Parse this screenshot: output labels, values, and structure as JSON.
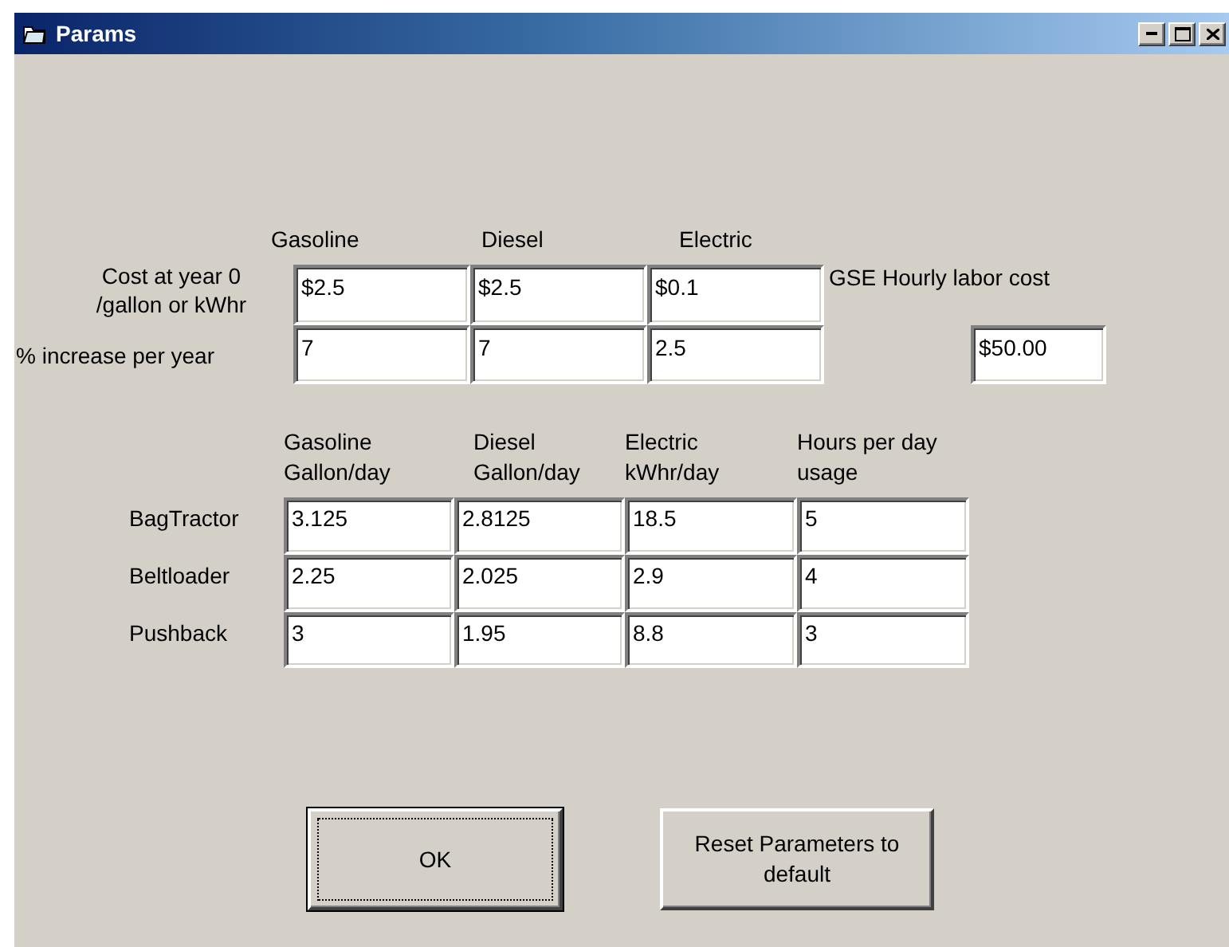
{
  "window": {
    "title": "Params"
  },
  "fuel_costs": {
    "columns": [
      "Gasoline",
      "Diesel",
      "Electric"
    ],
    "rows": [
      {
        "label": [
          "Cost at year 0",
          "/gallon or kWhr"
        ],
        "values": [
          "$2.5",
          "$2.5",
          "$0.1"
        ]
      },
      {
        "label": [
          "% increase per year"
        ],
        "values": [
          "7",
          "7",
          "2.5"
        ]
      }
    ]
  },
  "labor": {
    "label": "GSE Hourly labor cost",
    "value": "$50.00"
  },
  "usage": {
    "columns": [
      [
        "Gasoline",
        "Gallon/day"
      ],
      [
        "Diesel",
        "Gallon/day"
      ],
      [
        "Electric",
        "kWhr/day"
      ],
      [
        "Hours per day",
        "usage"
      ]
    ],
    "rows": [
      {
        "label": "BagTractor",
        "values": [
          "3.125",
          "2.8125",
          "18.5",
          "5"
        ]
      },
      {
        "label": "Beltloader",
        "values": [
          "2.25",
          "2.025",
          "2.9",
          "4"
        ]
      },
      {
        "label": "Pushback",
        "values": [
          "3",
          "1.95",
          "8.8",
          "3"
        ]
      }
    ]
  },
  "buttons": [
    {
      "label": "OK",
      "default": true
    },
    {
      "label": "Reset Parameters to default",
      "default": false
    }
  ]
}
